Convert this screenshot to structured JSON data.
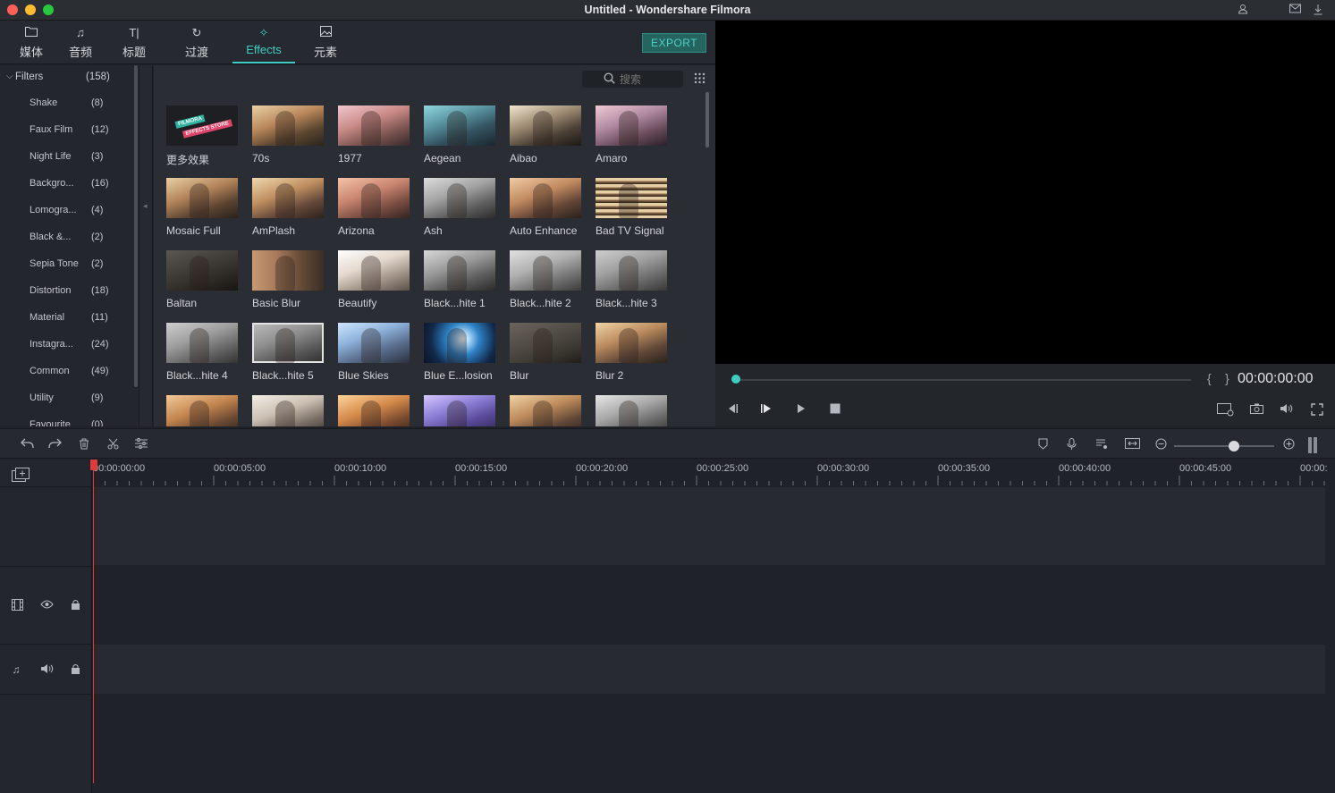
{
  "window": {
    "title": "Untitled - Wondershare Filmora"
  },
  "tabs": [
    {
      "label": "媒体",
      "icon": "folder-icon"
    },
    {
      "label": "音频",
      "icon": "music-note-icon"
    },
    {
      "label": "标题",
      "icon": "text-icon"
    },
    {
      "label": "过渡",
      "icon": "transition-icon"
    },
    {
      "label": "Effects",
      "icon": "effects-icon",
      "active": true
    },
    {
      "label": "元素",
      "icon": "image-icon"
    }
  ],
  "export_label": "EXPORT",
  "filters": {
    "header_label": "Filters",
    "header_count": "(158)",
    "items": [
      {
        "name": "Shake",
        "count": "(8)"
      },
      {
        "name": "Faux Film",
        "count": "(12)"
      },
      {
        "name": "Night Life",
        "count": "(3)"
      },
      {
        "name": "Backgro...",
        "count": "(16)"
      },
      {
        "name": "Lomogra...",
        "count": "(4)"
      },
      {
        "name": "Black &...",
        "count": "(2)"
      },
      {
        "name": "Sepia Tone",
        "count": "(2)"
      },
      {
        "name": "Distortion",
        "count": "(18)"
      },
      {
        "name": "Material",
        "count": "(11)"
      },
      {
        "name": "Instagra...",
        "count": "(24)"
      },
      {
        "name": "Common",
        "count": "(49)"
      },
      {
        "name": "Utility",
        "count": "(9)"
      },
      {
        "name": "Favourite",
        "count": "(0)"
      }
    ]
  },
  "search": {
    "placeholder": "搜索"
  },
  "store_thumb": {
    "line1": "FILMORA",
    "line2": "EFFECTS STORE"
  },
  "effects": [
    "更多效果",
    "70s",
    "1977",
    "Aegean",
    "Aibao",
    "Amaro",
    "Mosaic Full",
    "AmPlash",
    "Arizona",
    "Ash",
    "Auto Enhance",
    "Bad TV Signal",
    "Baltan",
    "Basic Blur",
    "Beautify",
    "Black...hite 1",
    "Black...hite 2",
    "Black...hite 3",
    "Black...hite 4",
    "Black...hite 5",
    "Blue Skies",
    "Blue E...losion",
    "Blur",
    "Blur 2",
    "",
    "",
    "",
    "",
    "",
    ""
  ],
  "colors": {
    "accent": "#3ecdc3",
    "playhead": "#e03b3b"
  },
  "player": {
    "timecode": "00:00:00:00",
    "mark_in": "{",
    "mark_out": "}"
  },
  "ruler": [
    "00:00:00:00",
    "00:00:05:00",
    "00:00:10:00",
    "00:00:15:00",
    "00:00:20:00",
    "00:00:25:00",
    "00:00:30:00",
    "00:00:35:00",
    "00:00:40:00",
    "00:00:45:00",
    "00:00:"
  ]
}
